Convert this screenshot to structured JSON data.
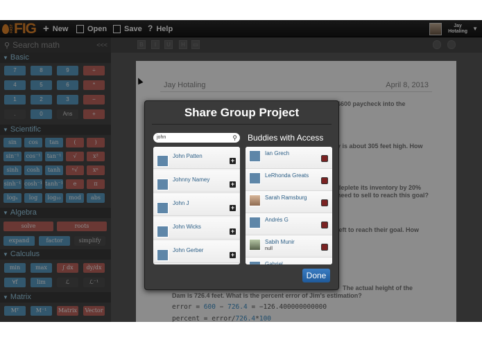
{
  "topbar": {
    "logo_small": "FAST",
    "logo": "FIG",
    "new_label": "New",
    "open_label": "Open",
    "save_label": "Save",
    "help_label": "Help",
    "user_first": "Jay",
    "user_last": "Hotaling"
  },
  "search": {
    "placeholder": "Search math",
    "collapse": "<<<"
  },
  "format": [
    "B",
    "I",
    "U",
    "H",
    "▭"
  ],
  "sidebar": {
    "sections": [
      {
        "title": "Basic"
      },
      {
        "title": "Scientific"
      },
      {
        "title": "Algebra"
      },
      {
        "title": "Calculus"
      },
      {
        "title": "Matrix"
      }
    ],
    "basic": [
      "7",
      "8",
      "9",
      "÷",
      "4",
      "5",
      "6",
      "*",
      "1",
      "2",
      "3",
      "−",
      ".",
      "0",
      "Ans",
      "+"
    ],
    "scientific": [
      "sin",
      "cos",
      "tan",
      "(",
      ")",
      "sin⁻¹",
      "cos⁻¹",
      "tan⁻¹",
      "√",
      "x²",
      "sinh",
      "cosh",
      "tanh",
      "ⁿ√",
      "xⁿ",
      "sinh⁻¹",
      "cosh⁻¹",
      "tanh⁻¹",
      "e",
      "π",
      "logₙ",
      "log",
      "log₁₀",
      "mod",
      "abs"
    ],
    "algebra": [
      "solve",
      "roots",
      "expand",
      "factor",
      "simplify"
    ],
    "calculus": [
      "min",
      "max",
      "∫ dx",
      "dy/dx",
      "∀f",
      "lim",
      "ℒ",
      "ℒ⁻¹"
    ],
    "matrix": [
      "Mᵀ",
      "M⁻¹",
      "Matrix",
      "Vector"
    ]
  },
  "document": {
    "author": "Jay Hotaling",
    "date": "April 8, 2013",
    "frag1": "$600 paycheck into the",
    "frag2a": "y is about 305 feet high.  How",
    "frag3a": "deplete its inventory by 20%",
    "frag3b": "need to sell to reach this goal?",
    "frag4": "left to reach their goal.  How",
    "frag5a": "Dam is 726.4 feet.  What is the percent error of Jim's estimation?",
    "frag5b": "The actual height of the",
    "code1_a": "error = ",
    "code1_b": "600",
    "code1_c": " − ",
    "code1_d": "726.4",
    "code1_e": " = −126.400000000000",
    "code2_a": "percent = error/",
    "code2_b": "726.4",
    "code2_c": "*",
    "code2_d": "100"
  },
  "modal": {
    "title": "Share Group Project",
    "search_value": "john",
    "buddies_title": "Buddies with Access",
    "results": [
      "John Patten",
      "Johnny Namey",
      "John J",
      "John Wicks",
      "John Gerber"
    ],
    "buddies": [
      {
        "name": "Ian Grech",
        "sub": ""
      },
      {
        "name": "LeRhonda Greats",
        "sub": ""
      },
      {
        "name": "Sarah Ramsburg",
        "sub": ""
      },
      {
        "name": "Andrés G",
        "sub": ""
      },
      {
        "name": "Sabih Munir",
        "sub": "null"
      },
      {
        "name": "Gabriel...",
        "sub": ""
      }
    ],
    "done_label": "Done"
  }
}
